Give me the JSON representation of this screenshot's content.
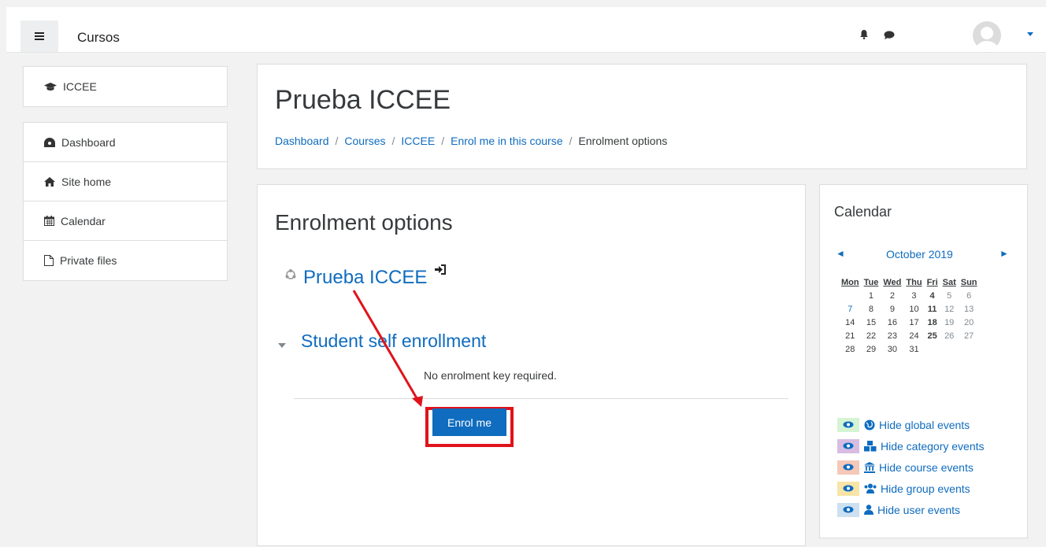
{
  "header": {
    "site_name": "Cursos",
    "icons": [
      "menu-icon",
      "bell-icon",
      "chat-icon",
      "avatar",
      "caret-down-icon"
    ]
  },
  "sidebar": {
    "course_item": "ICCEE",
    "items": [
      {
        "label": "Dashboard",
        "icon": "dashboard-icon"
      },
      {
        "label": "Site home",
        "icon": "home-icon"
      },
      {
        "label": "Calendar",
        "icon": "calendar-icon"
      },
      {
        "label": "Private files",
        "icon": "file-icon"
      }
    ]
  },
  "page": {
    "title": "Prueba ICCEE",
    "breadcrumb": [
      "Dashboard",
      "Courses",
      "ICCEE",
      "Enrol me in this course",
      "Enrolment options"
    ],
    "breadcrumb_separator": "/"
  },
  "main": {
    "heading": "Enrolment options",
    "course_link": "Prueba ICCEE",
    "section_title": "Student self enrollment",
    "no_key_text": "No enrolment key required.",
    "enrol_button": "Enrol me"
  },
  "calendar": {
    "title": "Calendar",
    "prev": "◄",
    "month": "October 2019",
    "next": "►",
    "weekdays": [
      "Mon",
      "Tue",
      "Wed",
      "Thu",
      "Fri",
      "Sat",
      "Sun"
    ],
    "weeks": [
      [
        "",
        "1",
        "2",
        "3",
        "4",
        "5",
        "6"
      ],
      [
        "7",
        "8",
        "9",
        "10",
        "11",
        "12",
        "13"
      ],
      [
        "14",
        "15",
        "16",
        "17",
        "18",
        "19",
        "20"
      ],
      [
        "21",
        "22",
        "23",
        "24",
        "25",
        "26",
        "27"
      ],
      [
        "28",
        "29",
        "30",
        "31",
        "",
        "",
        ""
      ]
    ],
    "events": [
      {
        "label": "Hide global events",
        "color": "#d4f4d4"
      },
      {
        "label": "Hide category events",
        "color": "#d7bde2"
      },
      {
        "label": "Hide course events",
        "color": "#f5c8b8"
      },
      {
        "label": "Hide group events",
        "color": "#f7e4a6"
      },
      {
        "label": "Hide user events",
        "color": "#cde0f0"
      }
    ]
  },
  "colors": {
    "brand": "#0f6cbf",
    "annotation": "#e0131b"
  }
}
